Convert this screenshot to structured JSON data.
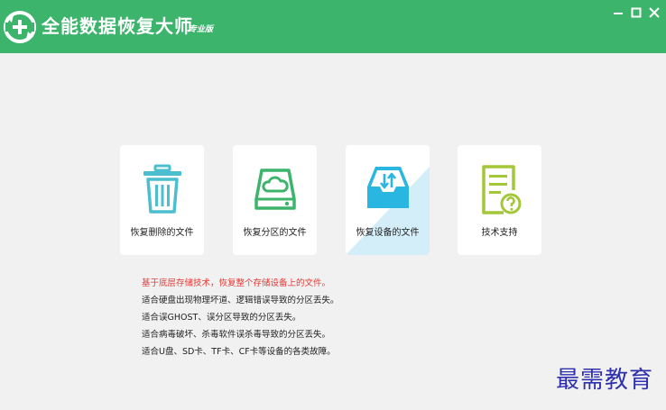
{
  "app": {
    "title": "全能数据恢复大师",
    "edition": "专业版",
    "brand_color": "#3cb46c"
  },
  "window_controls": [
    {
      "name": "minimize-button",
      "icon": "minimize-icon"
    },
    {
      "name": "maximize-button",
      "icon": "maximize-icon"
    },
    {
      "name": "close-button",
      "icon": "close-icon"
    }
  ],
  "cards": [
    {
      "label": "恢复删除的文件",
      "icon": "trash-can-icon",
      "icon_color": "#4bbfcf"
    },
    {
      "label": "恢复分区的文件",
      "icon": "hard-drive-cloud-icon",
      "icon_color": "#3cb46c"
    },
    {
      "label": "恢复设备的文件",
      "icon": "device-sync-icon",
      "icon_color": "#29b6e0",
      "active": true
    },
    {
      "label": "技术支持",
      "icon": "document-help-icon",
      "icon_color": "#a4c639"
    }
  ],
  "description": {
    "highlight": "基于底层存储技术，恢复整个存储设备上的文件。",
    "lines": [
      "适合硬盘出现物理坏道、逻辑错误导致的分区丢失。",
      "适合误GHOST、误分区导致的分区丢失。",
      "适合病毒破坏、杀毒软件误杀毒导致的分区丢失。",
      "适合U盘、SD卡、TF卡、CF卡等设备的各类故障。"
    ]
  },
  "watermark": "最需教育"
}
